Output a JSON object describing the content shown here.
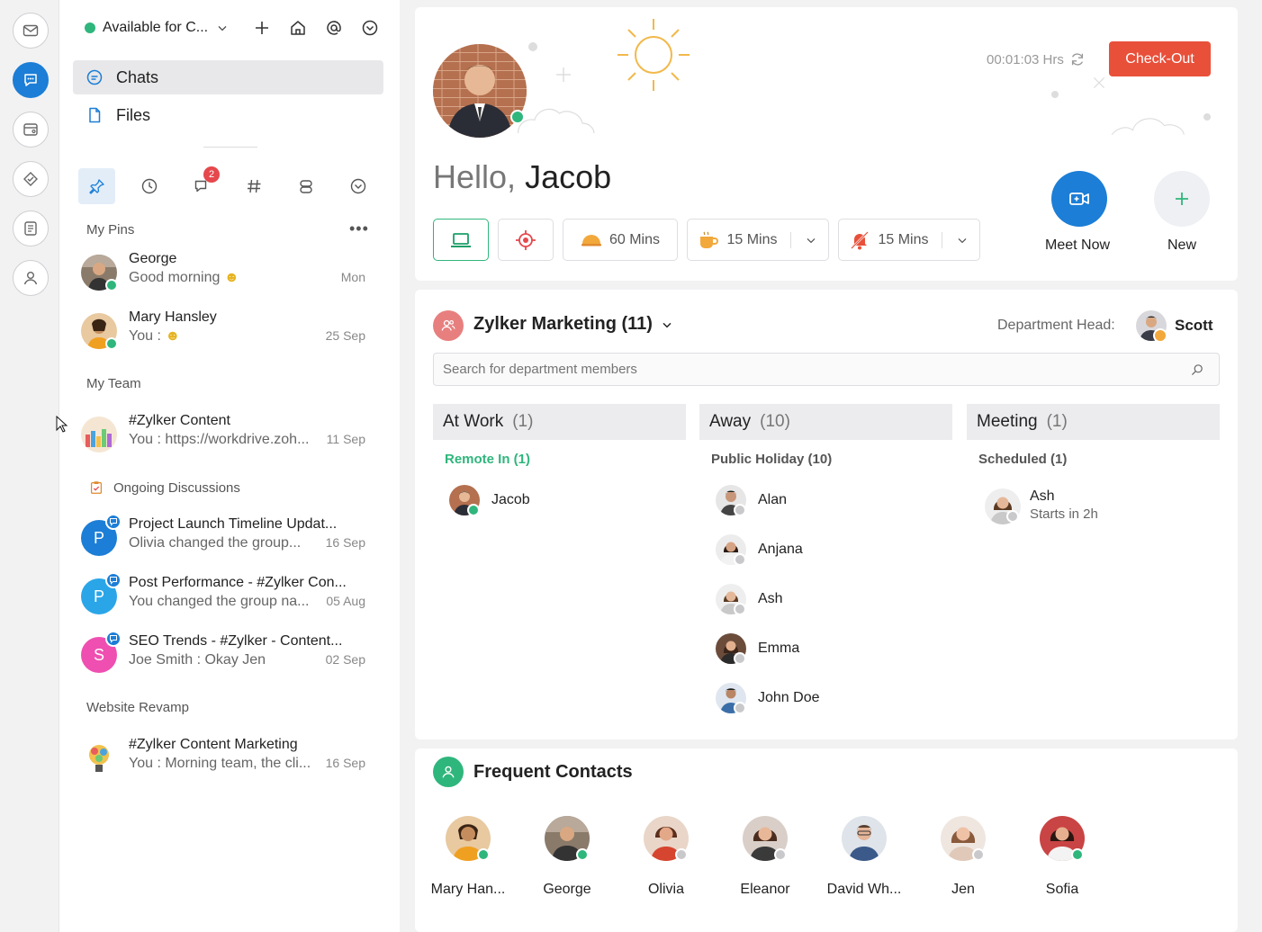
{
  "status": {
    "label": "Available for C...",
    "color": "#2fb67c"
  },
  "nav": {
    "chats": "Chats",
    "files": "Files"
  },
  "filter": {
    "badge_count": "2"
  },
  "pins": {
    "label": "My Pins",
    "items": [
      {
        "title": "George",
        "subtitle": "Good morning",
        "time": "Mon"
      },
      {
        "title": "Mary Hansley",
        "subtitle": "You :",
        "time": "25 Sep"
      }
    ]
  },
  "team": {
    "label": "My Team",
    "items": [
      {
        "title": "#Zylker Content",
        "subtitle": "You : https://workdrive.zoh...",
        "time": "11 Sep"
      }
    ]
  },
  "discussions": {
    "label": "Ongoing Discussions",
    "items": [
      {
        "letter": "P",
        "title": "Project Launch Timeline Updat...",
        "subtitle": "Olivia changed the group...",
        "time": "16 Sep"
      },
      {
        "letter": "P",
        "title": "Post Performance - #Zylker Con...",
        "subtitle": "You changed the group na...",
        "time": "05 Aug"
      },
      {
        "letter": "S",
        "title": "SEO Trends - #Zylker - Content...",
        "subtitle": "Joe Smith : Okay Jen",
        "time": "02 Sep"
      }
    ]
  },
  "website": {
    "label": "Website Revamp",
    "items": [
      {
        "title": "#Zylker Content Marketing",
        "subtitle": "You : Morning team, the cli...",
        "time": "16 Sep"
      }
    ]
  },
  "hero": {
    "greeting": "Hello,",
    "name": "Jacob",
    "timer": "00:01:03 Hrs",
    "checkout": "Check-Out",
    "chips": {
      "lunch": "60 Mins",
      "coffee": "15 Mins",
      "dnd": "15 Mins"
    },
    "meet_now": "Meet Now",
    "new": "New"
  },
  "department": {
    "title": "Zylker Marketing (11)",
    "head_label": "Department Head:",
    "head_name": "Scott",
    "search_placeholder": "Search for department members",
    "columns": [
      {
        "title": "At Work",
        "count": "(1)",
        "sub": "Remote In (1)",
        "members": [
          {
            "name": "Jacob"
          }
        ]
      },
      {
        "title": "Away",
        "count": "(10)",
        "sub": "Public Holiday (10)",
        "members": [
          {
            "name": "Alan"
          },
          {
            "name": "Anjana"
          },
          {
            "name": "Ash"
          },
          {
            "name": "Emma"
          },
          {
            "name": "John Doe"
          }
        ]
      },
      {
        "title": "Meeting",
        "count": "(1)",
        "sub": "Scheduled (1)",
        "members": [
          {
            "name": "Ash",
            "note": "Starts in 2h"
          }
        ]
      }
    ]
  },
  "frequent": {
    "title": "Frequent Contacts",
    "contacts": [
      {
        "name": "Mary Han..."
      },
      {
        "name": "George"
      },
      {
        "name": "Olivia"
      },
      {
        "name": "Eleanor"
      },
      {
        "name": "David Wh..."
      },
      {
        "name": "Jen"
      },
      {
        "name": "Sofia"
      }
    ]
  },
  "colors": {
    "accent": "#1c7ed6",
    "online": "#2fb67c",
    "checkout": "#e8503a",
    "remote": "#2fb67c"
  }
}
